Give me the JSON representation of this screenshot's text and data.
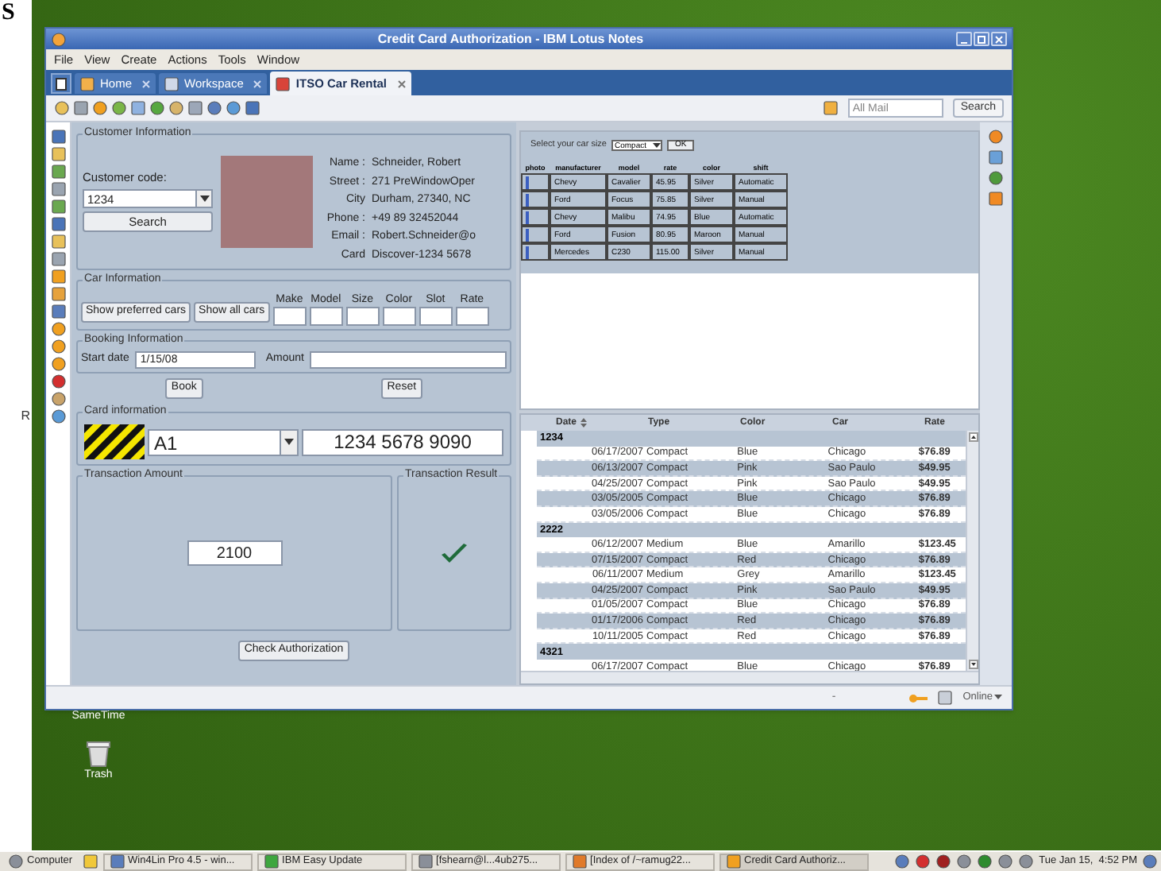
{
  "margin_texts": [
    "S",
    "R"
  ],
  "window": {
    "title": "Credit Card Authorization - IBM Lotus Notes"
  },
  "menu": [
    "File",
    "View",
    "Create",
    "Actions",
    "Tools",
    "Window"
  ],
  "tabs": [
    {
      "label": "Home",
      "selected": false
    },
    {
      "label": "Workspace",
      "selected": false
    },
    {
      "label": "ITSO Car Rental",
      "selected": true
    }
  ],
  "toolbar": {
    "search": {
      "placeholder": "All Mail"
    },
    "search_button": "Search"
  },
  "customer": {
    "title": "Customer Information",
    "code_label": "Customer code:",
    "code": "1234",
    "search_button": "Search",
    "fields": [
      {
        "label": "Name :",
        "value": "Schneider, Robert"
      },
      {
        "label": "Street :",
        "value": "271 PreWindowOper"
      },
      {
        "label": "City",
        "value": "Durham, 27340, NC"
      },
      {
        "label": "Phone :",
        "value": "+49 89 32452044"
      },
      {
        "label": "Email :",
        "value": "Robert.Schneider@o"
      },
      {
        "label": "Card",
        "value": "Discover-1234 5678"
      }
    ]
  },
  "car": {
    "title": "Car Information",
    "buttons": [
      "Show preferred cars",
      "Show all cars"
    ],
    "columns": [
      "Make",
      "Model",
      "Size",
      "Color",
      "Slot",
      "Rate"
    ]
  },
  "booking": {
    "title": "Booking Information",
    "start_label": "Start date",
    "start_date": "1/15/08",
    "amount_label": "Amount",
    "buttons": [
      "Book",
      "Reset"
    ]
  },
  "card": {
    "title": "Card information",
    "type": "A1",
    "number": "1234 5678 9090"
  },
  "transaction": {
    "amount_title": "Transaction Amount",
    "amount": "2100",
    "result_title": "Transaction Result",
    "result_ok": true
  },
  "check_button": "Check Authorization",
  "car_picker": {
    "label": "Select your car size",
    "size": "Compact",
    "ok": "OK",
    "columns": [
      "photo",
      "manufacturer",
      "model",
      "rate",
      "color",
      "shift"
    ],
    "rows": [
      [
        "",
        "Chevy",
        "Cavalier",
        "45.95",
        "Silver",
        "Automatic"
      ],
      [
        "",
        "Ford",
        "Focus",
        "75.85",
        "Silver",
        "Manual"
      ],
      [
        "",
        "Chevy",
        "Malibu",
        "74.95",
        "Blue",
        "Automatic"
      ],
      [
        "",
        "Ford",
        "Fusion",
        "80.95",
        "Maroon",
        "Manual"
      ],
      [
        "",
        "Mercedes",
        "C230",
        "115.00",
        "Silver",
        "Manual"
      ]
    ]
  },
  "bookings": {
    "columns": [
      "Date",
      "Type",
      "Color",
      "Car",
      "Rate"
    ],
    "groups": [
      {
        "label": "1234",
        "children": [
          [
            "06/17/2007",
            "Compact",
            "Blue",
            "Chicago",
            "$76.89"
          ],
          [
            "06/13/2007",
            "Compact",
            "Pink",
            "Sao Paulo",
            "$49.95"
          ],
          [
            "04/25/2007",
            "Compact",
            "Pink",
            "Sao Paulo",
            "$49.95"
          ],
          [
            "03/05/2005",
            "Compact",
            "Blue",
            "Chicago",
            "$76.89"
          ],
          [
            "03/05/2006",
            "Compact",
            "Blue",
            "Chicago",
            "$76.89"
          ]
        ]
      },
      {
        "label": "2222",
        "children": [
          [
            "06/12/2007",
            "Medium",
            "Blue",
            "Amarillo",
            "$123.45"
          ],
          [
            "07/15/2007",
            "Compact",
            "Red",
            "Chicago",
            "$76.89"
          ],
          [
            "06/11/2007",
            "Medium",
            "Grey",
            "Amarillo",
            "$123.45"
          ],
          [
            "04/25/2007",
            "Compact",
            "Pink",
            "Sao Paulo",
            "$49.95"
          ],
          [
            "01/05/2007",
            "Compact",
            "Blue",
            "Chicago",
            "$76.89"
          ],
          [
            "01/17/2006",
            "Compact",
            "Red",
            "Chicago",
            "$76.89"
          ],
          [
            "10/11/2005",
            "Compact",
            "Red",
            "Chicago",
            "$76.89"
          ]
        ]
      },
      {
        "label": "4321",
        "children": [
          [
            "06/17/2007",
            "Compact",
            "Blue",
            "Chicago",
            "$76.89"
          ]
        ]
      }
    ]
  },
  "status_bar": {
    "separator": "-",
    "presence": "Online"
  },
  "desktop_icons": [
    "SameTime",
    "Trash"
  ],
  "taskbar": {
    "items": [
      "Computer",
      "Win4Lin Pro 4.5 - win...",
      "IBM Easy Update",
      "[fshearn@l...4ub275...",
      "[Index of /~ramug22...",
      "Credit Card Authoriz..."
    ],
    "clock": "Tue Jan 15,  4:52 PM"
  }
}
